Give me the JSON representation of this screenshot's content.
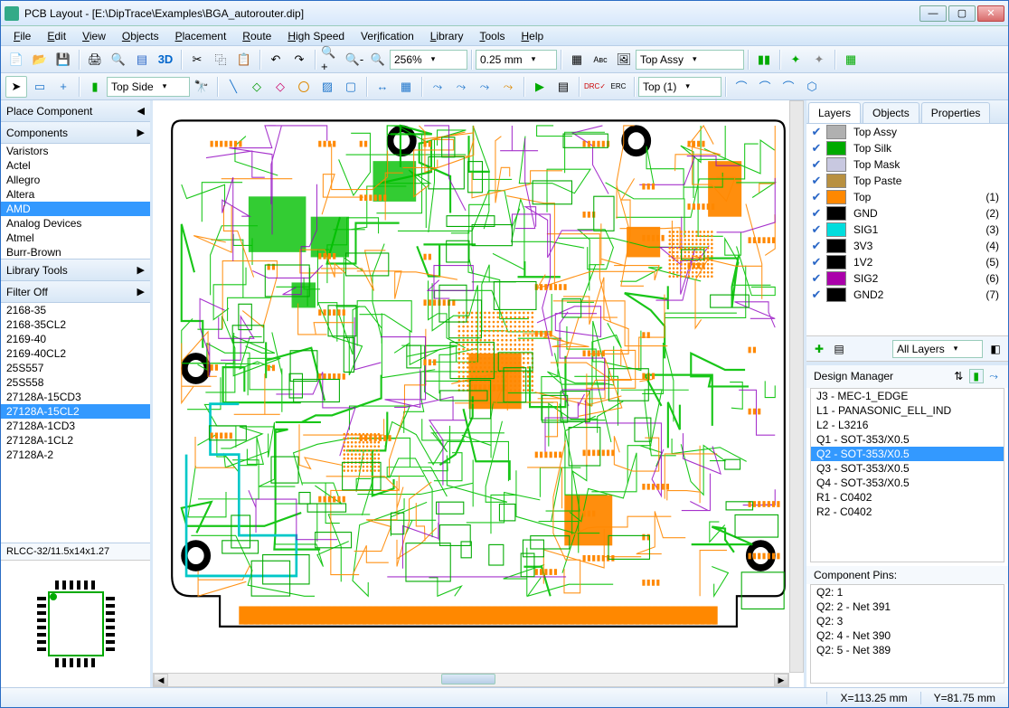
{
  "title": "PCB Layout - [E:\\DipTrace\\Examples\\BGA_autorouter.dip]",
  "menu": [
    "File",
    "Edit",
    "View",
    "Objects",
    "Placement",
    "Route",
    "High Speed",
    "Verification",
    "Library",
    "Tools",
    "Help"
  ],
  "toolbar1": {
    "zoom": "256%",
    "grid": "0.25 mm",
    "assy": "Top Assy"
  },
  "toolbar2": {
    "side": "Top Side",
    "layer": "Top (1)"
  },
  "left": {
    "place_header": "Place Component",
    "components_header": "Components",
    "component_libs": [
      "Varistors",
      "Actel",
      "Allegro",
      "Altera",
      "AMD",
      "Analog Devices",
      "Atmel",
      "Burr-Brown"
    ],
    "component_libs_selected": "AMD",
    "library_tools": "Library Tools",
    "filter": "Filter Off",
    "parts": [
      "2168-35",
      "2168-35CL2",
      "2169-40",
      "2169-40CL2",
      "25S557",
      "25S558",
      "27128A-15CD3",
      "27128A-15CL2",
      "27128A-1CD3",
      "27128A-1CL2",
      "27128A-2"
    ],
    "parts_selected": "27128A-15CL2",
    "footprint": "RLCC-32/11.5x14x1.27"
  },
  "right": {
    "tabs": [
      "Layers",
      "Objects",
      "Properties"
    ],
    "active_tab": "Layers",
    "layers": [
      {
        "name": "Top Assy",
        "color": "#b0b0b0",
        "num": ""
      },
      {
        "name": "Top Silk",
        "color": "#00aa00",
        "num": ""
      },
      {
        "name": "Top Mask",
        "color": "#c8c8e0",
        "num": ""
      },
      {
        "name": "Top Paste",
        "color": "#b89040",
        "num": ""
      },
      {
        "name": "Top",
        "color": "#ff8800",
        "num": "(1)"
      },
      {
        "name": "GND",
        "color": "#000000",
        "num": "(2)"
      },
      {
        "name": "SIG1",
        "color": "#00dddd",
        "num": "(3)"
      },
      {
        "name": "3V3",
        "color": "#000000",
        "num": "(4)"
      },
      {
        "name": "1V2",
        "color": "#000000",
        "num": "(5)"
      },
      {
        "name": "SIG2",
        "color": "#aa00aa",
        "num": "(6)"
      },
      {
        "name": "GND2",
        "color": "#000000",
        "num": "(7)"
      }
    ],
    "layers_filter": "All Layers",
    "dm_header": "Design Manager",
    "dm_items": [
      "J3 - MEC-1_EDGE",
      "L1 - PANASONIC_ELL_IND",
      "L2 - L3216",
      "Q1 - SOT-353/X0.5",
      "Q2 - SOT-353/X0.5",
      "Q3 - SOT-353/X0.5",
      "Q4 - SOT-353/X0.5",
      "R1 - C0402",
      "R2 - C0402"
    ],
    "dm_selected": "Q2 - SOT-353/X0.5",
    "pins_header": "Component Pins:",
    "pins": [
      "Q2: 1",
      "Q2: 2 - Net 391",
      "Q2: 3",
      "Q2: 4 - Net 390",
      "Q2: 5 - Net 389"
    ]
  },
  "status": {
    "x": "X=113.25 mm",
    "y": "Y=81.75 mm"
  }
}
